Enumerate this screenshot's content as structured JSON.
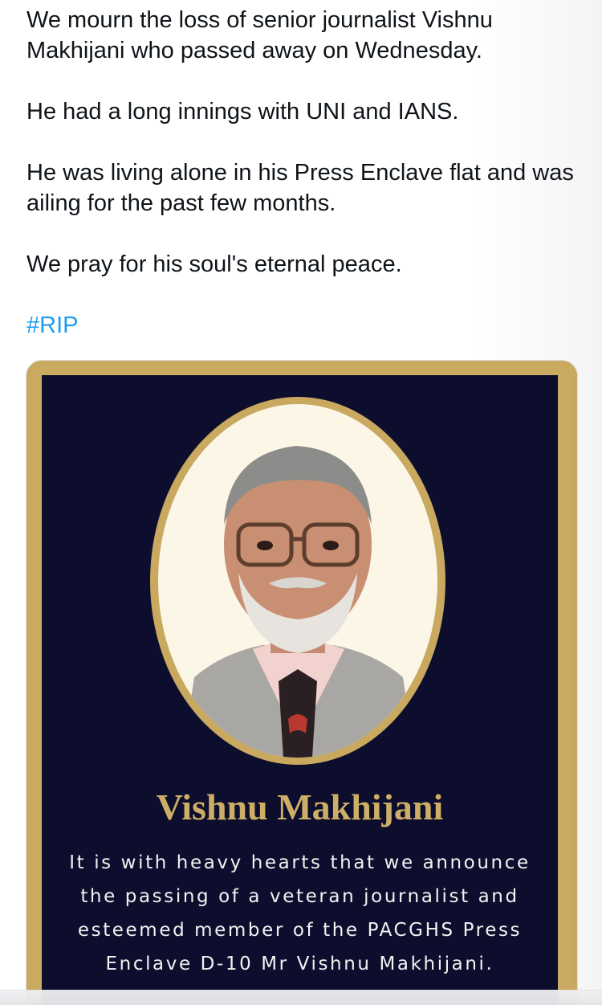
{
  "post": {
    "paragraphs": [
      "We mourn the loss of senior journalist Vishnu Makhijani who passed away on Wednesday.",
      "He had a long innings with UNI and IANS.",
      "He was living alone in his Press Enclave flat and was ailing for the past few months.",
      "We pray for his soul's eternal peace."
    ],
    "hashtag": "#RIP"
  },
  "poster": {
    "name": "Vishnu Makhijani",
    "announcement_lines": [
      "It is with heavy hearts that we announce",
      "the passing of a veteran journalist and",
      "esteemed member of the PACGHS Press",
      "Enclave D-10 Mr Vishnu Makhijani."
    ],
    "colors": {
      "background": "#0d0e2d",
      "gold": "#cbab62",
      "text": "#f2f2f2"
    }
  },
  "colors": {
    "body_text": "#0f1419",
    "link": "#1d9bf0"
  },
  "icons": {
    "portrait": "portrait-photo"
  }
}
